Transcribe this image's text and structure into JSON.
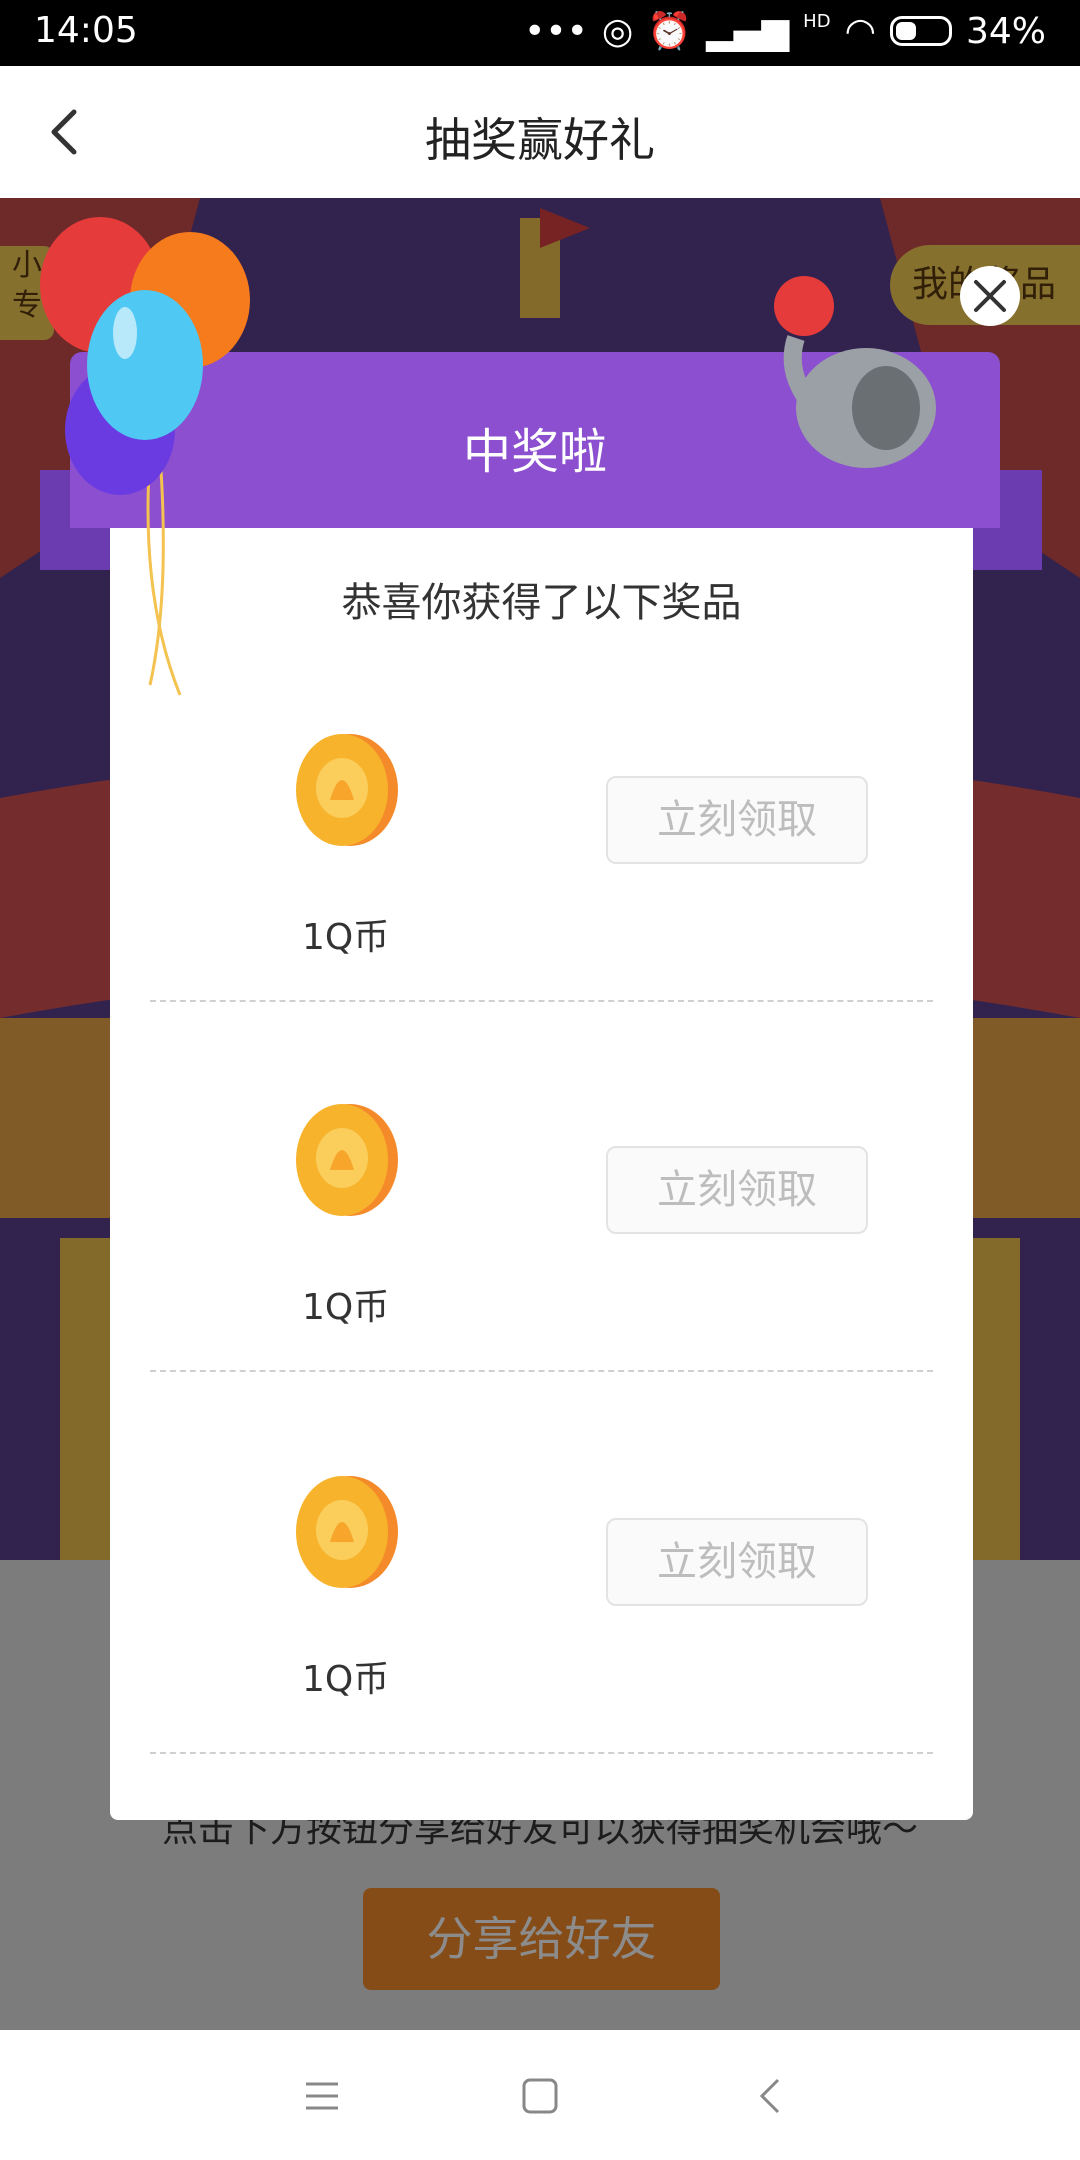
{
  "status_bar": {
    "time": "14:05",
    "battery": "34%",
    "hd_label": "HD"
  },
  "nav": {
    "title": "抽奖赢好礼"
  },
  "background": {
    "side_tag": "小\n专",
    "my_prizes": "我的奖品",
    "hint": "点击下方按钮分享给好友可以获得抽奖机会哦～",
    "share_button": "分享给好友"
  },
  "modal": {
    "banner_title": "中奖啦",
    "subtitle": "恭喜你获得了以下奖品",
    "prizes": [
      {
        "name": "1Q币",
        "claim_label": "立刻领取"
      },
      {
        "name": "1Q币",
        "claim_label": "立刻领取"
      },
      {
        "name": "1Q币",
        "claim_label": "立刻领取"
      }
    ]
  },
  "colors": {
    "banner": "#8b4fcf",
    "coin": "#f7b32b",
    "button_disabled_text": "#bdbdbd"
  }
}
